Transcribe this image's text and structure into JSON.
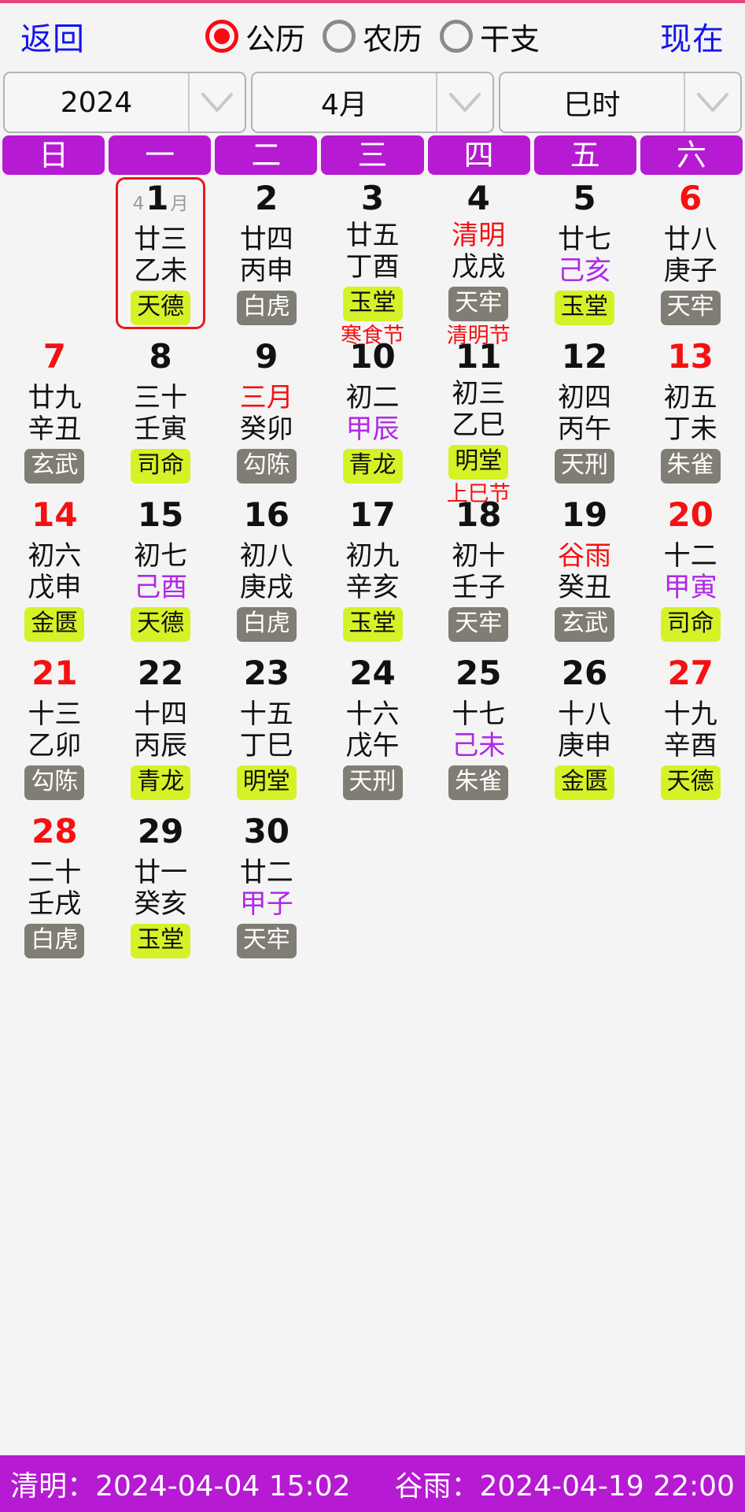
{
  "topbar": {
    "back_label": "返回",
    "now_label": "现在",
    "calendar_modes": [
      {
        "label": "公历",
        "selected": true
      },
      {
        "label": "农历",
        "selected": false
      },
      {
        "label": "干支",
        "selected": false
      }
    ]
  },
  "selectors": [
    {
      "name": "year",
      "value": "2024"
    },
    {
      "name": "month",
      "value": "4月"
    },
    {
      "name": "hour",
      "value": "巳时"
    }
  ],
  "weekdays": [
    "日",
    "一",
    "二",
    "三",
    "四",
    "五",
    "六"
  ],
  "weeks": [
    [
      {
        "blank": true
      },
      {
        "day": "1",
        "month_prefix": "4",
        "month_suffix": "月",
        "selected": true,
        "lunar": "廿三",
        "ganzhi": "乙未",
        "badge": "天德",
        "badge_type": "good"
      },
      {
        "day": "2",
        "lunar": "廿四",
        "ganzhi": "丙申",
        "badge": "白虎",
        "badge_type": "bad"
      },
      {
        "day": "3",
        "lunar": "廿五",
        "ganzhi": "丁酉",
        "badge": "玉堂",
        "badge_type": "good",
        "festival": "寒食节"
      },
      {
        "day": "4",
        "lunar": "清明",
        "lunar_red": true,
        "ganzhi": "戊戌",
        "badge": "天牢",
        "badge_type": "bad",
        "festival": "清明节"
      },
      {
        "day": "5",
        "lunar": "廿七",
        "ganzhi": "己亥",
        "ganzhi_purple": true,
        "badge": "玉堂",
        "badge_type": "good"
      },
      {
        "day": "6",
        "day_red": true,
        "lunar": "廿八",
        "ganzhi": "庚子",
        "badge": "天牢",
        "badge_type": "bad"
      }
    ],
    [
      {
        "day": "7",
        "day_red": true,
        "lunar": "廿九",
        "ganzhi": "辛丑",
        "badge": "玄武",
        "badge_type": "bad"
      },
      {
        "day": "8",
        "lunar": "三十",
        "ganzhi": "壬寅",
        "badge": "司命",
        "badge_type": "good"
      },
      {
        "day": "9",
        "lunar": "三月",
        "lunar_red": true,
        "ganzhi": "癸卯",
        "badge": "勾陈",
        "badge_type": "bad"
      },
      {
        "day": "10",
        "lunar": "初二",
        "ganzhi": "甲辰",
        "ganzhi_purple": true,
        "badge": "青龙",
        "badge_type": "good"
      },
      {
        "day": "11",
        "lunar": "初三",
        "ganzhi": "乙巳",
        "badge": "明堂",
        "badge_type": "good",
        "festival": "上巳节"
      },
      {
        "day": "12",
        "lunar": "初四",
        "ganzhi": "丙午",
        "badge": "天刑",
        "badge_type": "bad"
      },
      {
        "day": "13",
        "day_red": true,
        "lunar": "初五",
        "ganzhi": "丁未",
        "badge": "朱雀",
        "badge_type": "bad"
      }
    ],
    [
      {
        "day": "14",
        "day_red": true,
        "lunar": "初六",
        "ganzhi": "戊申",
        "badge": "金匮",
        "badge_type": "good"
      },
      {
        "day": "15",
        "lunar": "初七",
        "ganzhi": "己酉",
        "ganzhi_purple": true,
        "badge": "天德",
        "badge_type": "good"
      },
      {
        "day": "16",
        "lunar": "初八",
        "ganzhi": "庚戌",
        "badge": "白虎",
        "badge_type": "bad"
      },
      {
        "day": "17",
        "lunar": "初九",
        "ganzhi": "辛亥",
        "badge": "玉堂",
        "badge_type": "good"
      },
      {
        "day": "18",
        "lunar": "初十",
        "ganzhi": "壬子",
        "badge": "天牢",
        "badge_type": "bad"
      },
      {
        "day": "19",
        "lunar": "谷雨",
        "lunar_red": true,
        "ganzhi": "癸丑",
        "badge": "玄武",
        "badge_type": "bad"
      },
      {
        "day": "20",
        "day_red": true,
        "lunar": "十二",
        "ganzhi": "甲寅",
        "ganzhi_purple": true,
        "badge": "司命",
        "badge_type": "good"
      }
    ],
    [
      {
        "day": "21",
        "day_red": true,
        "lunar": "十三",
        "ganzhi": "乙卯",
        "badge": "勾陈",
        "badge_type": "bad"
      },
      {
        "day": "22",
        "lunar": "十四",
        "ganzhi": "丙辰",
        "badge": "青龙",
        "badge_type": "good"
      },
      {
        "day": "23",
        "lunar": "十五",
        "ganzhi": "丁巳",
        "badge": "明堂",
        "badge_type": "good"
      },
      {
        "day": "24",
        "lunar": "十六",
        "ganzhi": "戊午",
        "badge": "天刑",
        "badge_type": "bad"
      },
      {
        "day": "25",
        "lunar": "十七",
        "ganzhi": "己未",
        "ganzhi_purple": true,
        "badge": "朱雀",
        "badge_type": "bad"
      },
      {
        "day": "26",
        "lunar": "十八",
        "ganzhi": "庚申",
        "badge": "金匮",
        "badge_type": "good"
      },
      {
        "day": "27",
        "day_red": true,
        "lunar": "十九",
        "ganzhi": "辛酉",
        "badge": "天德",
        "badge_type": "good"
      }
    ],
    [
      {
        "day": "28",
        "day_red": true,
        "lunar": "二十",
        "ganzhi": "壬戌",
        "badge": "白虎",
        "badge_type": "bad"
      },
      {
        "day": "29",
        "lunar": "廿一",
        "ganzhi": "癸亥",
        "badge": "玉堂",
        "badge_type": "good"
      },
      {
        "day": "30",
        "lunar": "廿二",
        "ganzhi": "甲子",
        "ganzhi_purple": true,
        "badge": "天牢",
        "badge_type": "bad"
      },
      {
        "blank": true
      },
      {
        "blank": true
      },
      {
        "blank": true
      },
      {
        "blank": true
      }
    ],
    [
      {
        "blank": true
      },
      {
        "blank": true
      },
      {
        "blank": true
      },
      {
        "blank": true
      },
      {
        "blank": true
      },
      {
        "blank": true
      },
      {
        "blank": true
      }
    ]
  ],
  "bottombar": {
    "terms": [
      "清明：2024-04-04  15:02",
      "谷雨：2024-04-19  22:00"
    ]
  },
  "colors": {
    "purple": "#b61ad2",
    "link_blue": "#1414ee",
    "red": "#f51111",
    "badge_good_bg": "#d5f227",
    "badge_bad_bg": "#7f7d74",
    "ganzhi_purple": "#b028e8",
    "page_bg": "#f4f4f4"
  }
}
